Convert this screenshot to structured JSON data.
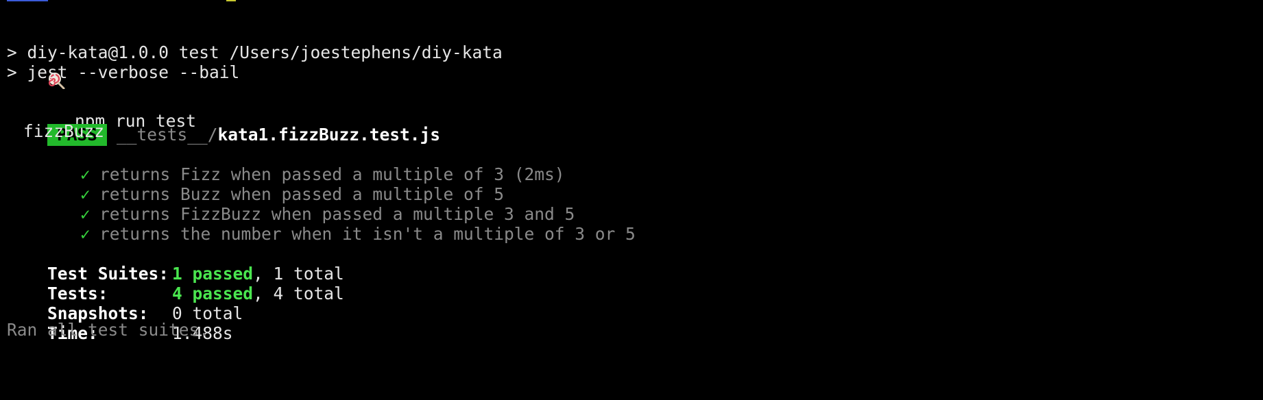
{
  "colors": {
    "background": "#000000",
    "text": "#e6e6e6",
    "pass_badge": "#22b92b",
    "passed_text": "#4ae64f",
    "check": "#36d13c",
    "dim": "#8a8a8a"
  },
  "prompt": {
    "icon": "lollipop-icon",
    "command": "npm run test"
  },
  "script_lines": [
    "> diy-kata@1.0.0 test /Users/joestephens/diy-kata",
    "> jest --verbose --bail"
  ],
  "result": {
    "status": "PASS",
    "path_dir": "__tests__/",
    "path_file": "kata1.fizzBuzz.test.js",
    "suite_name": "fizzBuzz",
    "check_icon": "check-icon",
    "check_glyph": "✓",
    "tests": [
      "returns Fizz when passed a multiple of 3 (2ms)",
      "returns Buzz when passed a multiple of 5",
      "returns FizzBuzz when passed a multiple 3 and 5",
      "returns the number when it isn't a multiple of 3 or 5"
    ]
  },
  "summary": {
    "suites_label": "Test Suites:",
    "suites_passed": "1 passed",
    "suites_total": ", 1 total",
    "tests_label": "Tests:",
    "tests_passed": "4 passed",
    "tests_total": ", 4 total",
    "snapshots_label": "Snapshots:",
    "snapshots_value": "0 total",
    "time_label": "Time:",
    "time_value": "1.488s",
    "footer": "Ran all test suites."
  }
}
